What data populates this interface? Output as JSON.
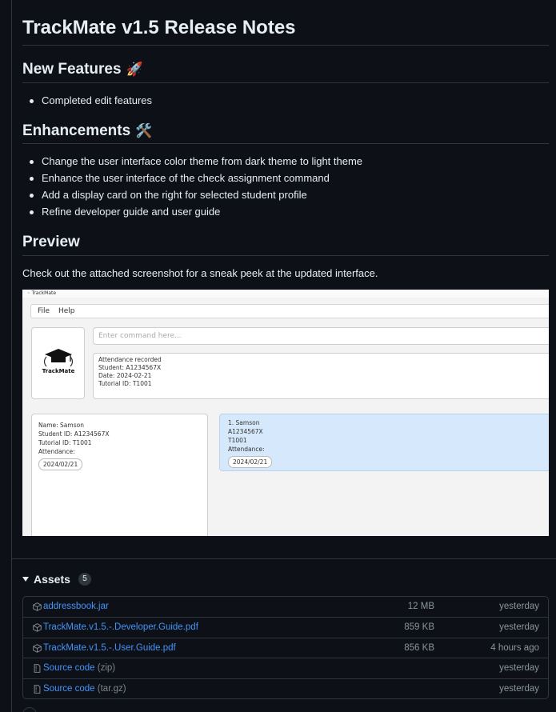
{
  "release": {
    "title": "TrackMate v1.5 Release Notes",
    "sections": [
      {
        "heading": "New Features",
        "emoji": "🚀",
        "items": [
          "Completed edit features"
        ]
      },
      {
        "heading": "Enhancements",
        "emoji": "🛠️",
        "items": [
          "Change the user interface color theme from dark theme to light theme",
          "Enhance the user interface of the check assignment command",
          "Add a display card on the right for selected student profile",
          "Refine developer guide and user guide"
        ]
      },
      {
        "heading": "Preview",
        "paragraph": "Check out the attached screenshot for a sneak peek at the updated interface."
      }
    ]
  },
  "screenshot": {
    "window_title": "TrackMate",
    "menu": [
      "File",
      "Help"
    ],
    "logo_text": "TrackMate",
    "command_placeholder": "Enter command here...",
    "result_lines": [
      "Attendance recorded",
      "Student: A1234567X",
      "Date: 2024-02-21",
      "Tutorial ID: T1001"
    ],
    "profile": {
      "name": "Name: Samson",
      "student_id": "Student ID: A1234567X",
      "tutorial_id": "Tutorial ID: T1001",
      "attendance_label": "Attendance:",
      "date": "2024/02/21"
    },
    "list_item": {
      "name": "1. Samson",
      "student_id": "A1234567X",
      "tutorial_id": "T1001",
      "attendance_label": "Attendance:",
      "date": "2024/02/21"
    }
  },
  "assets": {
    "title": "Assets",
    "count": "5",
    "items": [
      {
        "name": "addressbook.jar",
        "suffix": "",
        "size": "12 MB",
        "date": "yesterday",
        "icon": "package-icon"
      },
      {
        "name": "TrackMate.v1.5.-.Developer.Guide.pdf",
        "suffix": "",
        "size": "859 KB",
        "date": "yesterday",
        "icon": "package-icon"
      },
      {
        "name": "TrackMate.v1.5.-.User.Guide.pdf",
        "suffix": "",
        "size": "856 KB",
        "date": "4 hours ago",
        "icon": "package-icon"
      },
      {
        "name": "Source code",
        "suffix": "(zip)",
        "size": "",
        "date": "yesterday",
        "icon": "file-zip-icon"
      },
      {
        "name": "Source code",
        "suffix": "(tar.gz)",
        "size": "",
        "date": "yesterday",
        "icon": "file-zip-icon"
      }
    ]
  },
  "colors": {
    "background": "#0d1117",
    "border": "#30363d",
    "link": "#4493f8",
    "muted": "#8b949e",
    "text": "#e6edf3"
  }
}
